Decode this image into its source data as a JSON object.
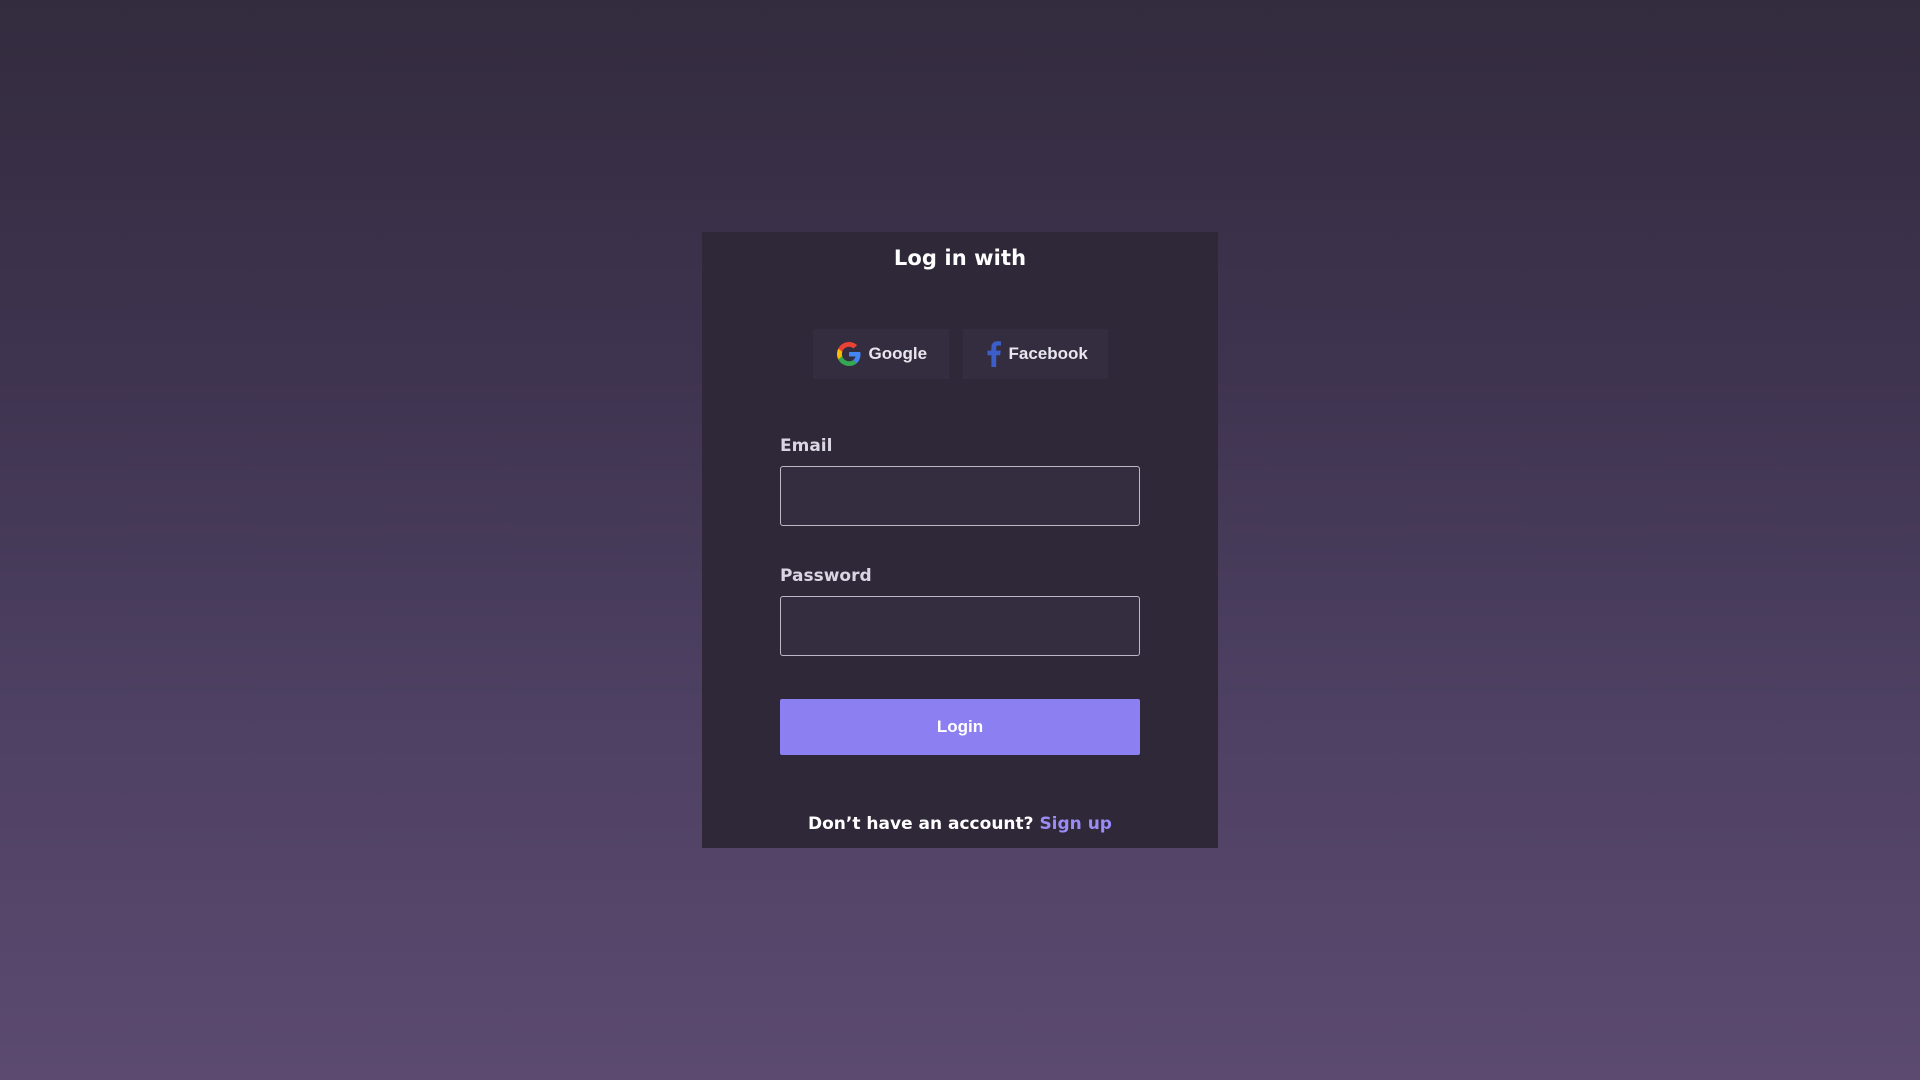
{
  "login_card": {
    "title": "Log in with",
    "social": {
      "google_label": "Google",
      "facebook_label": "Facebook",
      "google_icon": "google-icon",
      "facebook_icon": "facebook-icon"
    },
    "email": {
      "label": "Email",
      "value": "",
      "placeholder": ""
    },
    "password": {
      "label": "Password",
      "value": "",
      "placeholder": ""
    },
    "login_button": "Login",
    "signup": {
      "prompt": "Don’t have an account?",
      "link": "Sign up"
    }
  },
  "colors": {
    "accent": "#8b7ff2",
    "link": "#9a8bf5",
    "card_bg": "#2f2839",
    "facebook_blue": "#3b5ec9"
  }
}
